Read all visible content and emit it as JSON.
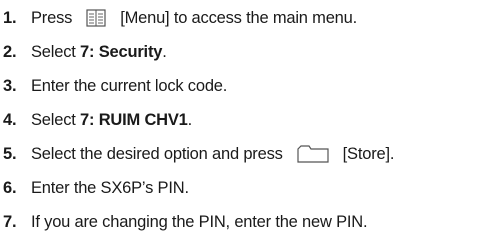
{
  "steps": [
    {
      "number": "1.",
      "parts": {
        "a": "Press",
        "icon": "menu-key-icon",
        "b": "[Menu] to access the main menu."
      }
    },
    {
      "number": "2.",
      "parts": {
        "a": "Select ",
        "bold": "7: Security",
        "b": "."
      }
    },
    {
      "number": "3.",
      "text": "Enter the current lock code."
    },
    {
      "number": "4.",
      "parts": {
        "a": "Select ",
        "bold": "7: RUIM CHV1",
        "b": "."
      }
    },
    {
      "number": "5.",
      "parts": {
        "a": "Select the desired option and press",
        "icon": "softkey-icon",
        "b": "[Store]."
      }
    },
    {
      "number": "6.",
      "text": "Enter the SX6P’s PIN."
    },
    {
      "number": "7.",
      "text": "If you are changing the PIN, enter the new PIN."
    }
  ]
}
